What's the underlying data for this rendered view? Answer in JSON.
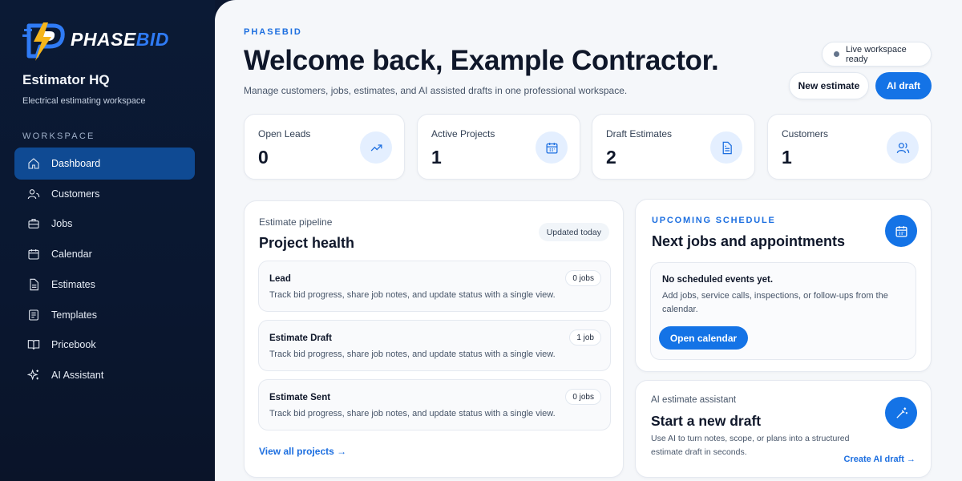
{
  "brand": {
    "name_part1": "PHASE",
    "name_part2": "BID",
    "small": "PHASEBID"
  },
  "sidebar": {
    "title": "Estimator HQ",
    "subtitle": "Electrical estimating workspace",
    "section_label": "WORKSPACE",
    "items": [
      {
        "label": "Dashboard",
        "icon": "home-icon",
        "active": true
      },
      {
        "label": "Customers",
        "icon": "user-icon"
      },
      {
        "label": "Jobs",
        "icon": "briefcase-icon"
      },
      {
        "label": "Calendar",
        "icon": "calendar-icon"
      },
      {
        "label": "Estimates",
        "icon": "document-icon"
      },
      {
        "label": "Templates",
        "icon": "template-icon"
      },
      {
        "label": "Pricebook",
        "icon": "book-icon"
      },
      {
        "label": "AI Assistant",
        "icon": "sparkles-icon"
      }
    ]
  },
  "header": {
    "title": "Welcome back, Example Contractor.",
    "subtitle": "Manage customers, jobs, estimates, and AI assisted drafts in one professional workspace.",
    "status": "Live workspace ready",
    "new_estimate_label": "New estimate",
    "ai_draft_label": "AI draft"
  },
  "stats": [
    {
      "label": "Open Leads",
      "value": "0",
      "icon": "trending-up-icon"
    },
    {
      "label": "Active Projects",
      "value": "1",
      "icon": "calendar-icon"
    },
    {
      "label": "Draft Estimates",
      "value": "2",
      "icon": "document-icon"
    },
    {
      "label": "Customers",
      "value": "1",
      "icon": "users-icon"
    }
  ],
  "pipeline": {
    "eyebrow": "Estimate pipeline",
    "title": "Project health",
    "updated": "Updated today",
    "stages": [
      {
        "name": "Lead",
        "count": "0 jobs",
        "desc": "Track bid progress, share job notes, and update status with a single view."
      },
      {
        "name": "Estimate Draft",
        "count": "1 job",
        "desc": "Track bid progress, share job notes, and update status with a single view."
      },
      {
        "name": "Estimate Sent",
        "count": "0 jobs",
        "desc": "Track bid progress, share job notes, and update status with a single view."
      }
    ],
    "view_all": "View all projects →"
  },
  "schedule": {
    "eyebrow": "UPCOMING SCHEDULE",
    "title": "Next jobs and appointments",
    "empty_title": "No scheduled events yet.",
    "empty_help": "Add jobs, service calls, inspections, or follow-ups from the calendar.",
    "button": "Open calendar"
  },
  "ai_assistant": {
    "eyebrow": "AI estimate assistant",
    "title": "Start a new draft",
    "desc": "Use AI to turn notes, scope, or plans into a structured estimate draft in seconds.",
    "link": "Create AI draft →"
  },
  "colors": {
    "accent": "#1473e6",
    "sidebar_bg": "#0b1a35",
    "active_nav": "#0f4a93"
  }
}
